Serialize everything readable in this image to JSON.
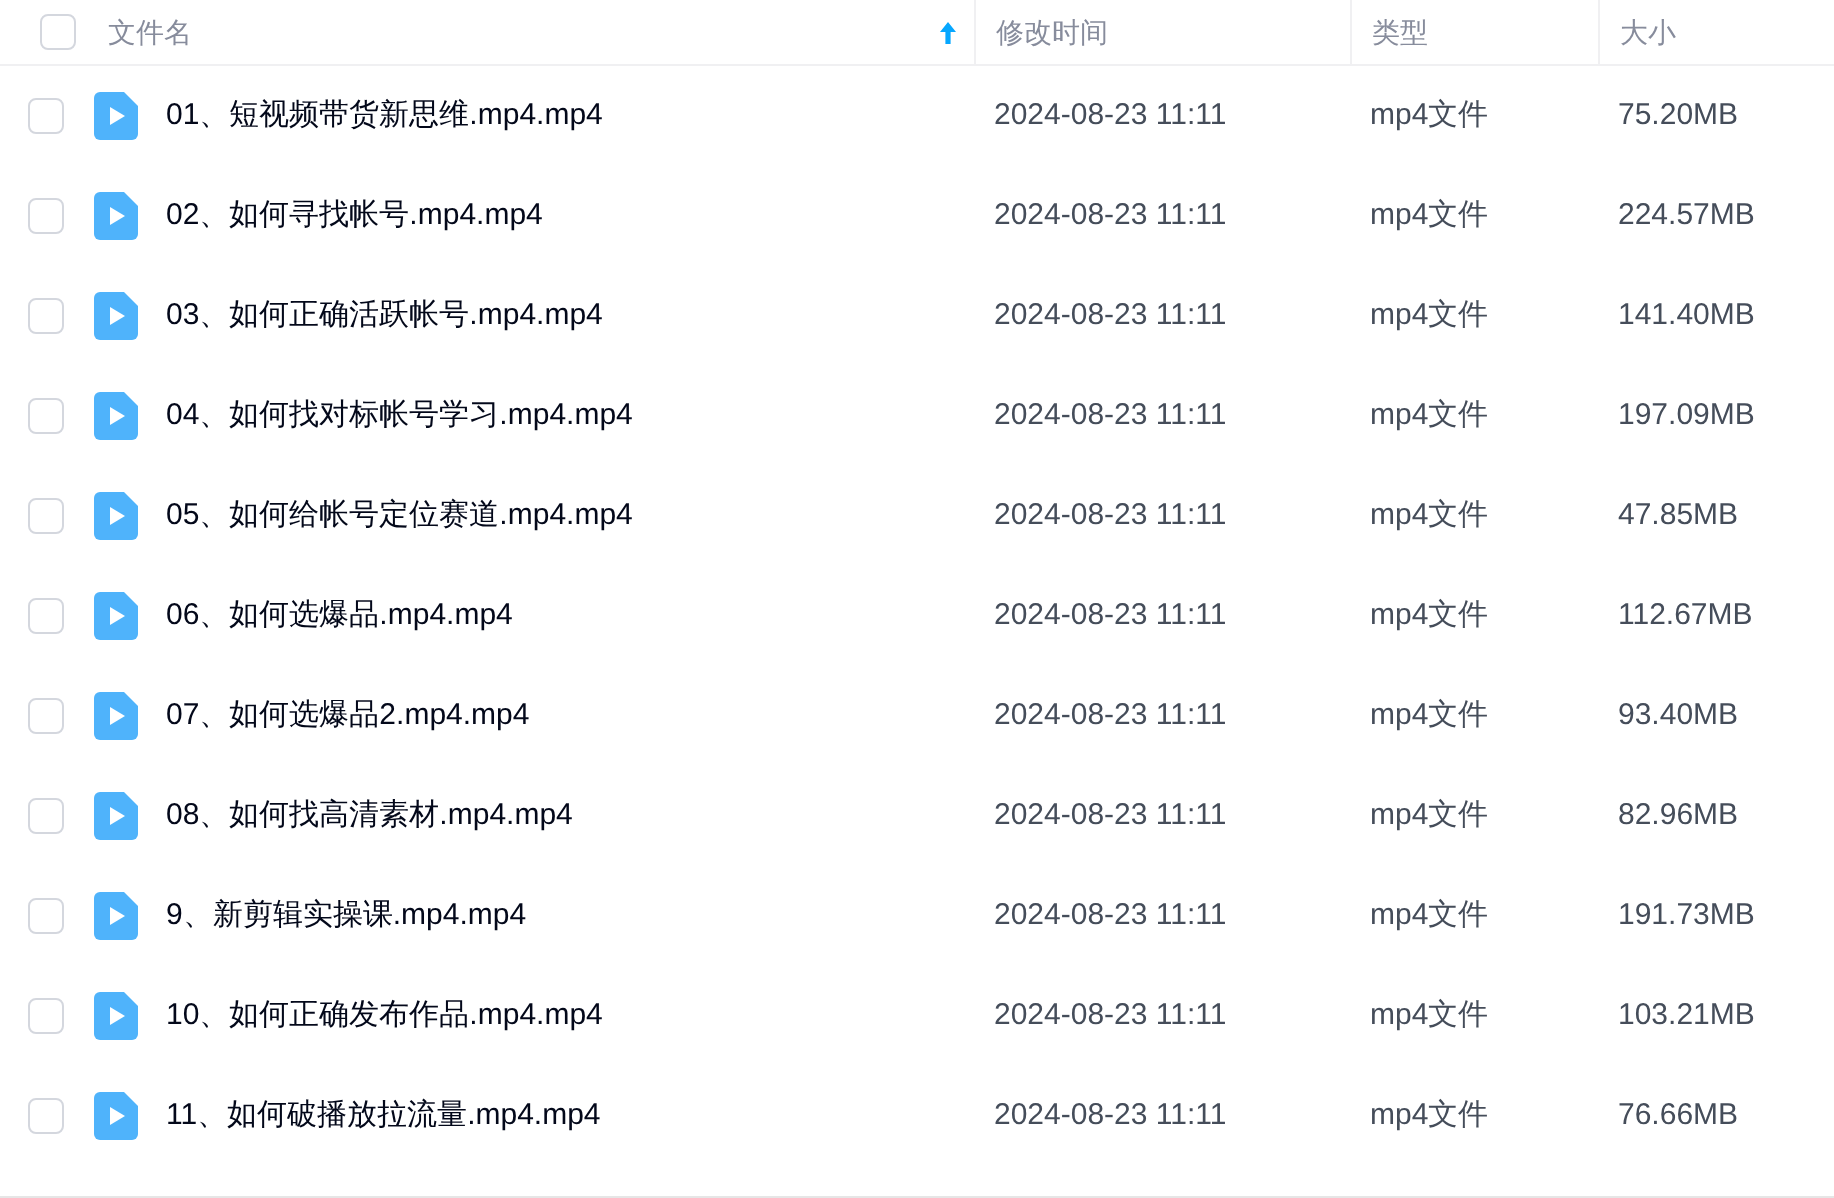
{
  "header": {
    "select_all": {
      "checked": false
    },
    "columns": [
      {
        "label": "文件名",
        "sorted_ascending": true
      },
      {
        "label": "修改时间",
        "sorted_ascending": false
      },
      {
        "label": "类型",
        "sorted_ascending": false
      },
      {
        "label": "大小",
        "sorted_ascending": false
      }
    ]
  },
  "rows": [
    {
      "checked": false,
      "name": "01、短视频带货新思维.mp4.mp4",
      "modified": "2024-08-23 11:11",
      "type": "mp4文件",
      "size": "75.20MB"
    },
    {
      "checked": false,
      "name": "02、如何寻找帐号.mp4.mp4",
      "modified": "2024-08-23 11:11",
      "type": "mp4文件",
      "size": "224.57MB"
    },
    {
      "checked": false,
      "name": "03、如何正确活跃帐号.mp4.mp4",
      "modified": "2024-08-23 11:11",
      "type": "mp4文件",
      "size": "141.40MB"
    },
    {
      "checked": false,
      "name": "04、如何找对标帐号学习.mp4.mp4",
      "modified": "2024-08-23 11:11",
      "type": "mp4文件",
      "size": "197.09MB"
    },
    {
      "checked": false,
      "name": "05、如何给帐号定位赛道.mp4.mp4",
      "modified": "2024-08-23 11:11",
      "type": "mp4文件",
      "size": "47.85MB"
    },
    {
      "checked": false,
      "name": "06、如何选爆品.mp4.mp4",
      "modified": "2024-08-23 11:11",
      "type": "mp4文件",
      "size": "112.67MB"
    },
    {
      "checked": false,
      "name": "07、如何选爆品2.mp4.mp4",
      "modified": "2024-08-23 11:11",
      "type": "mp4文件",
      "size": "93.40MB"
    },
    {
      "checked": false,
      "name": "08、如何找高清素材.mp4.mp4",
      "modified": "2024-08-23 11:11",
      "type": "mp4文件",
      "size": "82.96MB"
    },
    {
      "checked": false,
      "name": "9、新剪辑实操课.mp4.mp4",
      "modified": "2024-08-23 11:11",
      "type": "mp4文件",
      "size": "191.73MB"
    },
    {
      "checked": false,
      "name": "10、如何正确发布作品.mp4.mp4",
      "modified": "2024-08-23 11:11",
      "type": "mp4文件",
      "size": "103.21MB"
    },
    {
      "checked": false,
      "name": "11、如何破播放拉流量.mp4.mp4",
      "modified": "2024-08-23 11:11",
      "type": "mp4文件",
      "size": "76.66MB"
    }
  ]
}
